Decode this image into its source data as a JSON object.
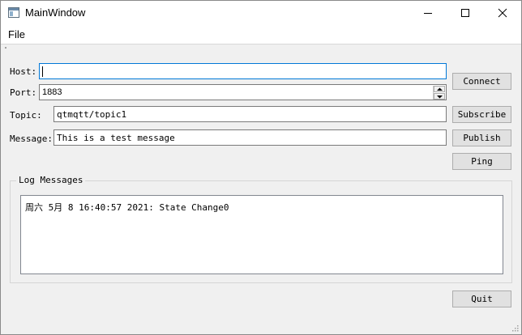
{
  "window": {
    "title": "MainWindow",
    "icons": {
      "app": "app-window-icon",
      "minimize": "minimize-icon",
      "maximize": "maximize-icon",
      "close": "close-icon"
    }
  },
  "menu": {
    "items": [
      "File"
    ]
  },
  "form": {
    "host": {
      "label": "Host:",
      "value": ""
    },
    "port": {
      "label": "Port:",
      "value": "1883"
    },
    "topic": {
      "label": "Topic:",
      "value": "qtmqtt/topic1"
    },
    "message": {
      "label": "Message:",
      "value": "This is a test message"
    }
  },
  "buttons": {
    "connect": "Connect",
    "subscribe": "Subscribe",
    "publish": "Publish",
    "ping": "Ping",
    "quit": "Quit"
  },
  "log": {
    "title": "Log Messages",
    "lines": [
      "周六 5月 8 16:40:57 2021: State Change0"
    ]
  },
  "colors": {
    "focus_border": "#0078d7",
    "background": "#f0f0f0",
    "button_face": "#e1e1e1"
  }
}
